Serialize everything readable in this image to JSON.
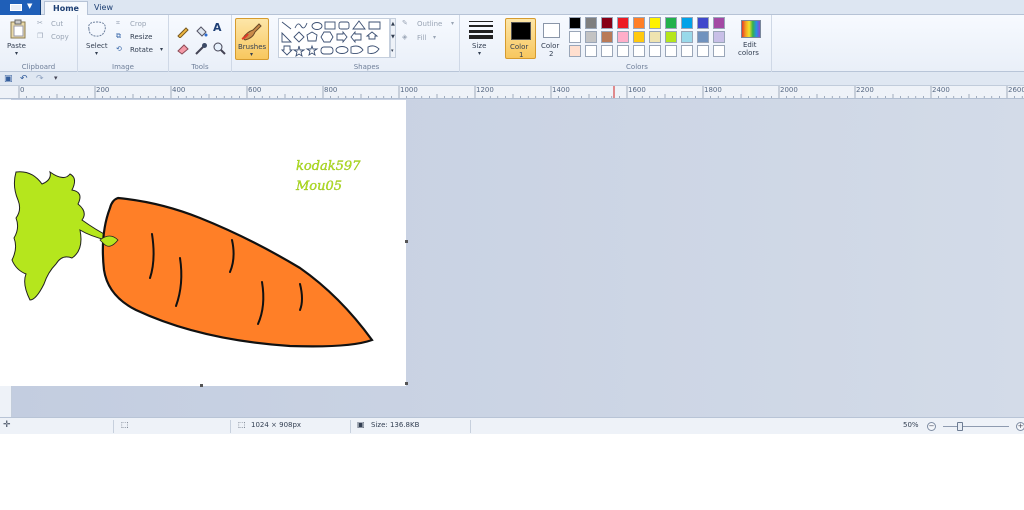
{
  "tabs": [
    {
      "label": "Home",
      "active": true
    },
    {
      "label": "View",
      "active": false
    }
  ],
  "ribbon": {
    "clipboard": {
      "label": "Clipboard",
      "paste": "Paste",
      "cut": "Cut",
      "copy": "Copy"
    },
    "image": {
      "label": "Image",
      "select": "Select",
      "crop": "Crop",
      "resize": "Resize",
      "rotate": "Rotate"
    },
    "tools": {
      "label": "Tools"
    },
    "brushes": {
      "label": "Brushes"
    },
    "shapes": {
      "label": "Shapes",
      "outline": "Outline",
      "fill": "Fill"
    },
    "size": {
      "label": "Size"
    },
    "color1": {
      "label": "Color",
      "number": "1",
      "value": "#000000"
    },
    "color2": {
      "label": "Color",
      "number": "2",
      "value": "#ffffff"
    },
    "colors": {
      "label": "Colors",
      "edit_line1": "Edit",
      "edit_line2": "colors",
      "palette_row1": [
        "#000000",
        "#7f7f7f",
        "#880015",
        "#ed1c24",
        "#ff7f27",
        "#fff200",
        "#22b14c",
        "#00a2e8",
        "#3f48cc",
        "#a349a4"
      ],
      "palette_row2": [
        "#ffffff",
        "#c3c3c3",
        "#b97a57",
        "#ffaec9",
        "#ffc90e",
        "#efe4b0",
        "#b5e61d",
        "#99d9ea",
        "#7092be",
        "#c8bfe7"
      ],
      "palette_row3": [
        "#ffdfcf",
        "#ffffff",
        "#ffffff",
        "#ffffff",
        "#ffffff",
        "#ffffff",
        "#ffffff",
        "#ffffff",
        "#ffffff",
        "#ffffff"
      ]
    }
  },
  "ruler": {
    "labels": [
      "0",
      "200",
      "400",
      "600",
      "800",
      "1000",
      "1200",
      "1400",
      "1600",
      "1800",
      "2000",
      "2200",
      "2400",
      "2600"
    ]
  },
  "canvas": {
    "text_line1": "kodak597",
    "text_line2": "Mou05",
    "carrot_color": "#ff7f27",
    "leaf_color": "#b5e61d"
  },
  "status": {
    "dimensions": "1024 × 908px",
    "size": "Size: 136.8KB",
    "zoom": "50%"
  }
}
